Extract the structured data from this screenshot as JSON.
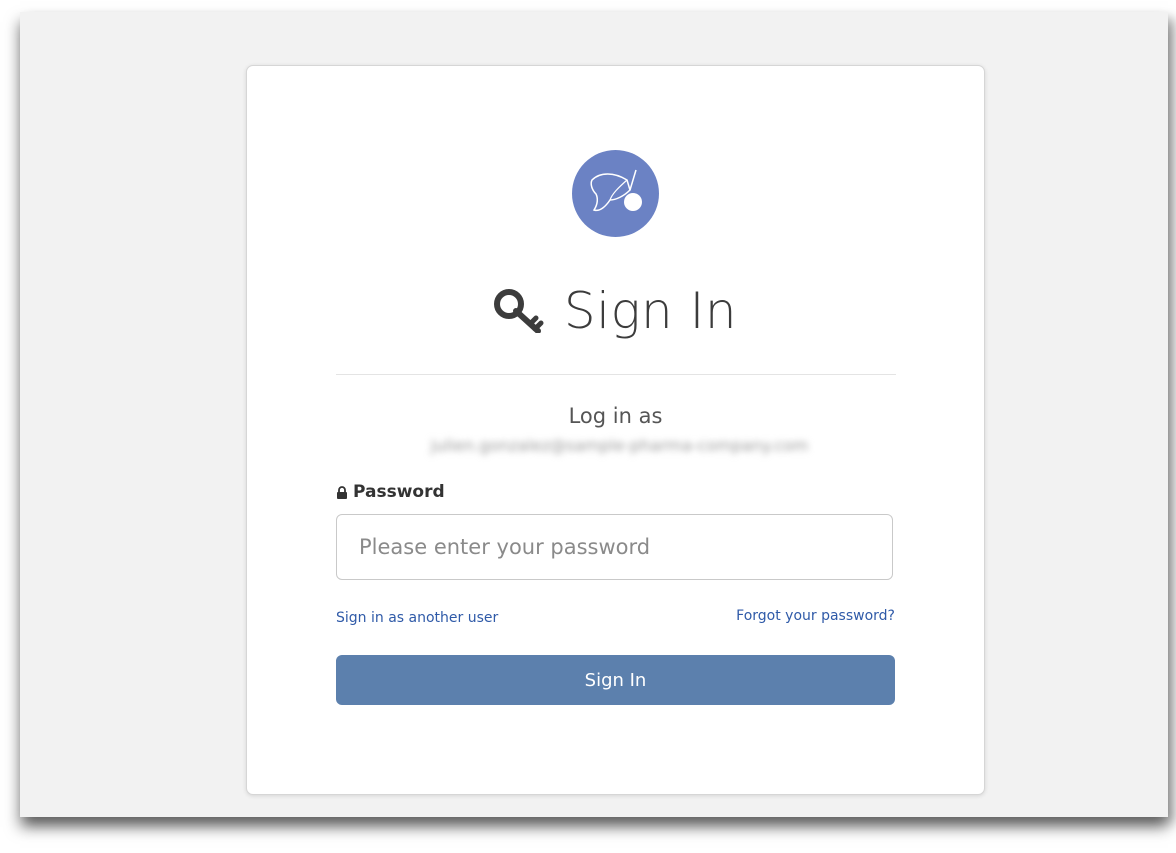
{
  "logo": {
    "icon": "butterfly-logo-icon",
    "color": "#6b82c4"
  },
  "header": {
    "title": "Sign In",
    "icon": "key-icon"
  },
  "login": {
    "prompt": "Log in as",
    "email": "julien.gonzalez@sample-pharma-company.com"
  },
  "password": {
    "label": "Password",
    "icon": "lock-icon",
    "placeholder": "Please enter your password",
    "value": ""
  },
  "links": {
    "another_user": "Sign in as another user",
    "forgot": "Forgot your password?"
  },
  "button": {
    "label": "Sign In",
    "color": "#5c80ad"
  }
}
